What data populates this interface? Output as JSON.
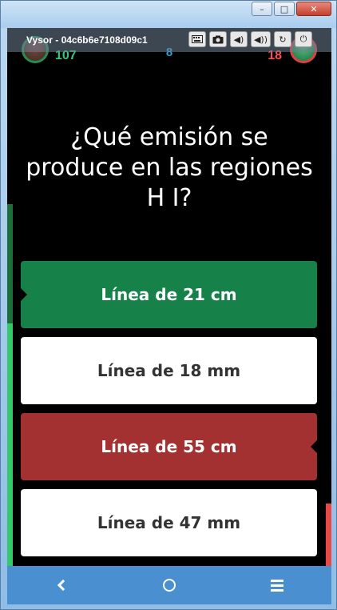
{
  "window": {
    "title": "Vysor - 04c6b6e7108d09c1",
    "minimize_glyph": "–",
    "maximize_glyph": "□",
    "close_glyph": "✕"
  },
  "vysor_toolbar": {
    "keyboard_icon": "keyboard-icon",
    "screenshot_icon": "camera-icon",
    "volume_down_glyph": "◀)",
    "volume_up_glyph": "◀))",
    "rotate_glyph": "↻",
    "power_glyph": "⏻"
  },
  "scoreboard": {
    "player_score": "107",
    "question_number": "8",
    "opponent_score": "18"
  },
  "question": {
    "text": "¿Qué emisión se produce en las regiones H I?"
  },
  "answers": [
    {
      "label": "Línea de 21 cm",
      "state": "correct"
    },
    {
      "label": "Línea de 18 mm",
      "state": "neutral"
    },
    {
      "label": "Línea de 55 cm",
      "state": "wrong"
    },
    {
      "label": "Línea de 47 mm",
      "state": "neutral"
    }
  ],
  "progress": {
    "player_time_fraction": 0.67,
    "opponent_time_fraction": 0.17
  },
  "colors": {
    "correct": "#16824a",
    "wrong": "#a33131",
    "player_score": "#38c67a",
    "question_number": "#2a9fd6",
    "opponent_score": "#ff4d4d",
    "nav_bar": "#4a8fd0"
  }
}
